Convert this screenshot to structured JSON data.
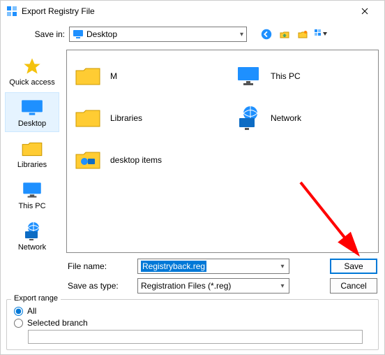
{
  "title": "Export Registry File",
  "savein_label": "Save in:",
  "savein_value": "Desktop",
  "places": [
    {
      "label": "Quick access"
    },
    {
      "label": "Desktop"
    },
    {
      "label": "Libraries"
    },
    {
      "label": "This PC"
    },
    {
      "label": "Network"
    }
  ],
  "files": [
    {
      "label": "M"
    },
    {
      "label": "This PC"
    },
    {
      "label": "Libraries"
    },
    {
      "label": "Network"
    },
    {
      "label": "desktop items"
    }
  ],
  "filename_label": "File name:",
  "filename_value": "Registryback.reg",
  "savetype_label": "Save as type:",
  "savetype_value": "Registration Files (*.reg)",
  "btn_save": "Save",
  "btn_cancel": "Cancel",
  "export_range_label": "Export range",
  "radio_all": "All",
  "radio_selected": "Selected branch"
}
